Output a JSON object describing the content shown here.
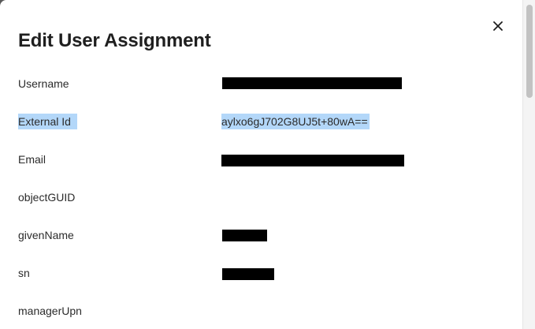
{
  "dialog": {
    "title": "Edit User Assignment",
    "close_label": "×"
  },
  "fields": [
    {
      "label": "Username",
      "value": ""
    },
    {
      "label": "External Id",
      "value": "aylxo6gJ702G8UJ5t+80wA=="
    },
    {
      "label": "Email",
      "value": ""
    },
    {
      "label": "objectGUID",
      "value": ""
    },
    {
      "label": "givenName",
      "value": ""
    },
    {
      "label": "sn",
      "value": ""
    },
    {
      "label": "managerUpn",
      "value": ""
    }
  ],
  "colors": {
    "selection": "#b3d7f9",
    "redaction": "#000000",
    "text": "#2b2b2b"
  },
  "icons": {
    "close": "close-icon"
  }
}
